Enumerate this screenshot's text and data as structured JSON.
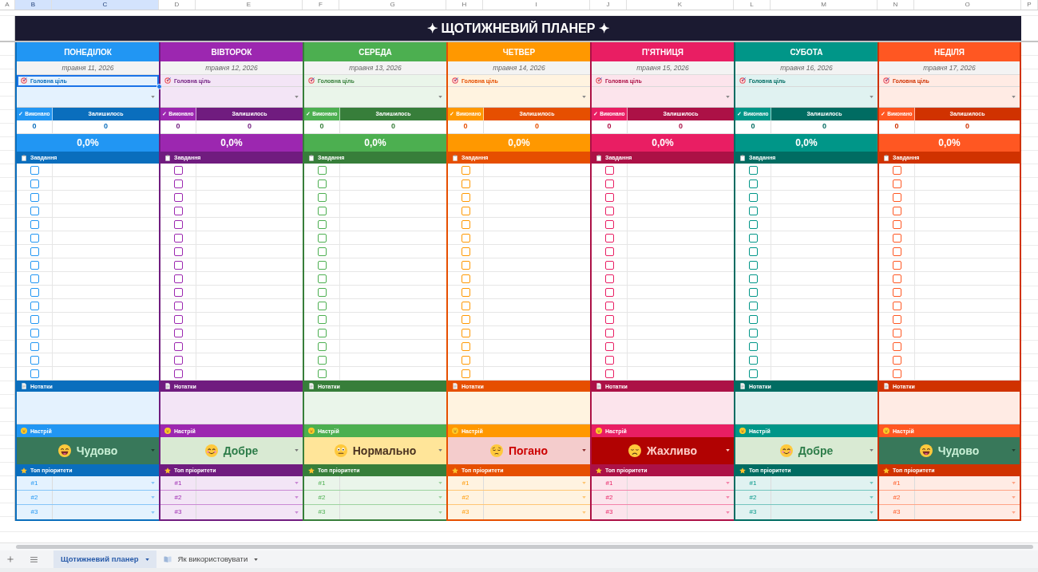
{
  "column_headers": [
    {
      "label": "A",
      "selected": false
    },
    {
      "label": "B",
      "selected": true
    },
    {
      "label": "C",
      "selected": true
    },
    {
      "label": "D",
      "selected": false
    },
    {
      "label": "E",
      "selected": false
    },
    {
      "label": "F",
      "selected": false
    },
    {
      "label": "G",
      "selected": false
    },
    {
      "label": "H",
      "selected": false
    },
    {
      "label": "I",
      "selected": false
    },
    {
      "label": "J",
      "selected": false
    },
    {
      "label": "K",
      "selected": false
    },
    {
      "label": "L",
      "selected": false
    },
    {
      "label": "M",
      "selected": false
    },
    {
      "label": "N",
      "selected": false
    },
    {
      "label": "O",
      "selected": false
    },
    {
      "label": "P",
      "selected": false
    }
  ],
  "title": "✦ ЩОТИЖНЕВИЙ ПЛАНЕР ✦",
  "days": [
    {
      "name": "ПОНЕДІЛОК",
      "date": "травня 11, 2026",
      "color": "#2196f3",
      "goal": {
        "label": "Головна ціль",
        "selected": true
      },
      "done_label": "✓ Виконано",
      "left_label": "Залишилось",
      "done_count": "0",
      "left_count": "0",
      "percent": "0,0%",
      "tasks_label": "Завдання",
      "tasks": [
        {
          "checked": false
        },
        {
          "checked": false
        },
        {
          "checked": false
        },
        {
          "checked": false
        },
        {
          "checked": false
        },
        {
          "checked": false
        },
        {
          "checked": false
        },
        {
          "checked": false
        },
        {
          "checked": false
        },
        {
          "checked": false
        },
        {
          "checked": false
        },
        {
          "checked": false
        },
        {
          "checked": false
        },
        {
          "checked": false
        },
        {
          "checked": false
        },
        {
          "checked": false
        }
      ],
      "notes_label": "Нотатки",
      "mood_label": "Настрій",
      "mood": {
        "kind": "great",
        "text": "Чудово"
      },
      "priorities_label": "Топ пріоритети",
      "priorities": [
        "#1",
        "#2",
        "#3"
      ]
    },
    {
      "name": "ВІВТОРОК",
      "date": "травня 12, 2026",
      "color": "#9c27b0",
      "goal": {
        "label": "Головна ціль",
        "selected": false
      },
      "done_label": "✓ Виконано",
      "left_label": "Залишилось",
      "done_count": "0",
      "left_count": "0",
      "percent": "0,0%",
      "tasks_label": "Завдання",
      "tasks": [
        {
          "checked": false
        },
        {
          "checked": false
        },
        {
          "checked": false
        },
        {
          "checked": false
        },
        {
          "checked": false
        },
        {
          "checked": false
        },
        {
          "checked": false
        },
        {
          "checked": false
        },
        {
          "checked": false
        },
        {
          "checked": false
        },
        {
          "checked": false
        },
        {
          "checked": false
        },
        {
          "checked": false
        },
        {
          "checked": false
        },
        {
          "checked": false
        },
        {
          "checked": false
        }
      ],
      "notes_label": "Нотатки",
      "mood_label": "Настрій",
      "mood": {
        "kind": "good",
        "text": "Добре"
      },
      "priorities_label": "Топ пріоритети",
      "priorities": [
        "#1",
        "#2",
        "#3"
      ]
    },
    {
      "name": "СЕРЕДА",
      "date": "травня 13, 2026",
      "color": "#4caf50",
      "goal": {
        "label": "Головна ціль",
        "selected": false
      },
      "done_label": "✓ Виконано",
      "left_label": "Залишилось",
      "done_count": "0",
      "left_count": "0",
      "percent": "0,0%",
      "tasks_label": "Завдання",
      "tasks": [
        {
          "checked": false
        },
        {
          "checked": false
        },
        {
          "checked": false
        },
        {
          "checked": false
        },
        {
          "checked": false
        },
        {
          "checked": false
        },
        {
          "checked": false
        },
        {
          "checked": false
        },
        {
          "checked": false
        },
        {
          "checked": false
        },
        {
          "checked": false
        },
        {
          "checked": false
        },
        {
          "checked": false
        },
        {
          "checked": false
        },
        {
          "checked": false
        },
        {
          "checked": false
        }
      ],
      "notes_label": "Нотатки",
      "mood_label": "Настрій",
      "mood": {
        "kind": "neutral",
        "text": "Нормально"
      },
      "priorities_label": "Топ пріоритети",
      "priorities": [
        "#1",
        "#2",
        "#3"
      ]
    },
    {
      "name": "ЧЕТВЕР",
      "date": "травня 14, 2026",
      "color": "#ff9800",
      "goal": {
        "label": "Головна ціль",
        "selected": false
      },
      "done_label": "✓ Виконано",
      "left_label": "Залишилось",
      "done_count": "0",
      "left_count": "0",
      "percent": "0,0%",
      "tasks_label": "Завдання",
      "tasks": [
        {
          "checked": false
        },
        {
          "checked": false
        },
        {
          "checked": false
        },
        {
          "checked": false
        },
        {
          "checked": false
        },
        {
          "checked": false
        },
        {
          "checked": false
        },
        {
          "checked": false
        },
        {
          "checked": false
        },
        {
          "checked": false
        },
        {
          "checked": false
        },
        {
          "checked": false
        },
        {
          "checked": false
        },
        {
          "checked": false
        },
        {
          "checked": false
        },
        {
          "checked": false
        }
      ],
      "notes_label": "Нотатки",
      "mood_label": "Настрій",
      "mood": {
        "kind": "bad",
        "text": "Погано"
      },
      "priorities_label": "Топ пріоритети",
      "priorities": [
        "#1",
        "#2",
        "#3"
      ]
    },
    {
      "name": "П'ЯТНИЦЯ",
      "date": "травня 15, 2026",
      "color": "#e91e63",
      "goal": {
        "label": "Головна ціль",
        "selected": false
      },
      "done_label": "✓ Виконано",
      "left_label": "Залишилось",
      "done_count": "0",
      "left_count": "0",
      "percent": "0,0%",
      "tasks_label": "Завдання",
      "tasks": [
        {
          "checked": false
        },
        {
          "checked": false
        },
        {
          "checked": false
        },
        {
          "checked": false
        },
        {
          "checked": false
        },
        {
          "checked": false
        },
        {
          "checked": false
        },
        {
          "checked": false
        },
        {
          "checked": false
        },
        {
          "checked": false
        },
        {
          "checked": false
        },
        {
          "checked": false
        },
        {
          "checked": false
        },
        {
          "checked": false
        },
        {
          "checked": false
        },
        {
          "checked": false
        }
      ],
      "notes_label": "Нотатки",
      "mood_label": "Настрій",
      "mood": {
        "kind": "awful",
        "text": "Жахливо"
      },
      "priorities_label": "Топ пріоритети",
      "priorities": [
        "#1",
        "#2",
        "#3"
      ]
    },
    {
      "name": "СУБОТА",
      "date": "травня 16, 2026",
      "color": "#009688",
      "goal": {
        "label": "Головна ціль",
        "selected": false
      },
      "done_label": "✓ Виконано",
      "left_label": "Залишилось",
      "done_count": "0",
      "left_count": "0",
      "percent": "0,0%",
      "tasks_label": "Завдання",
      "tasks": [
        {
          "checked": false
        },
        {
          "checked": false
        },
        {
          "checked": false
        },
        {
          "checked": false
        },
        {
          "checked": false
        },
        {
          "checked": false
        },
        {
          "checked": false
        },
        {
          "checked": false
        },
        {
          "checked": false
        },
        {
          "checked": false
        },
        {
          "checked": false
        },
        {
          "checked": false
        },
        {
          "checked": false
        },
        {
          "checked": false
        },
        {
          "checked": false
        },
        {
          "checked": false
        }
      ],
      "notes_label": "Нотатки",
      "mood_label": "Настрій",
      "mood": {
        "kind": "good",
        "text": "Добре"
      },
      "priorities_label": "Топ пріоритети",
      "priorities": [
        "#1",
        "#2",
        "#3"
      ]
    },
    {
      "name": "НЕДІЛЯ",
      "date": "травня 17, 2026",
      "color": "#ff5722",
      "goal": {
        "label": "Головна ціль",
        "selected": false
      },
      "done_label": "✓ Виконано",
      "left_label": "Залишилось",
      "done_count": "0",
      "left_count": "0",
      "percent": "0,0%",
      "tasks_label": "Завдання",
      "tasks": [
        {
          "checked": false
        },
        {
          "checked": false
        },
        {
          "checked": false
        },
        {
          "checked": false
        },
        {
          "checked": false
        },
        {
          "checked": false
        },
        {
          "checked": false
        },
        {
          "checked": false
        },
        {
          "checked": false
        },
        {
          "checked": false
        },
        {
          "checked": false
        },
        {
          "checked": false
        },
        {
          "checked": false
        },
        {
          "checked": false
        },
        {
          "checked": false
        },
        {
          "checked": false
        }
      ],
      "notes_label": "Нотатки",
      "mood_label": "Настрій",
      "mood": {
        "kind": "great",
        "text": "Чудово"
      },
      "priorities_label": "Топ пріоритети",
      "priorities": [
        "#1",
        "#2",
        "#3"
      ]
    }
  ],
  "sheet_tabs": [
    {
      "label": "Щотижневий планер",
      "selected": true,
      "kind": "plain"
    },
    {
      "label": "Як використовувати",
      "selected": false,
      "kind": "icon"
    }
  ]
}
